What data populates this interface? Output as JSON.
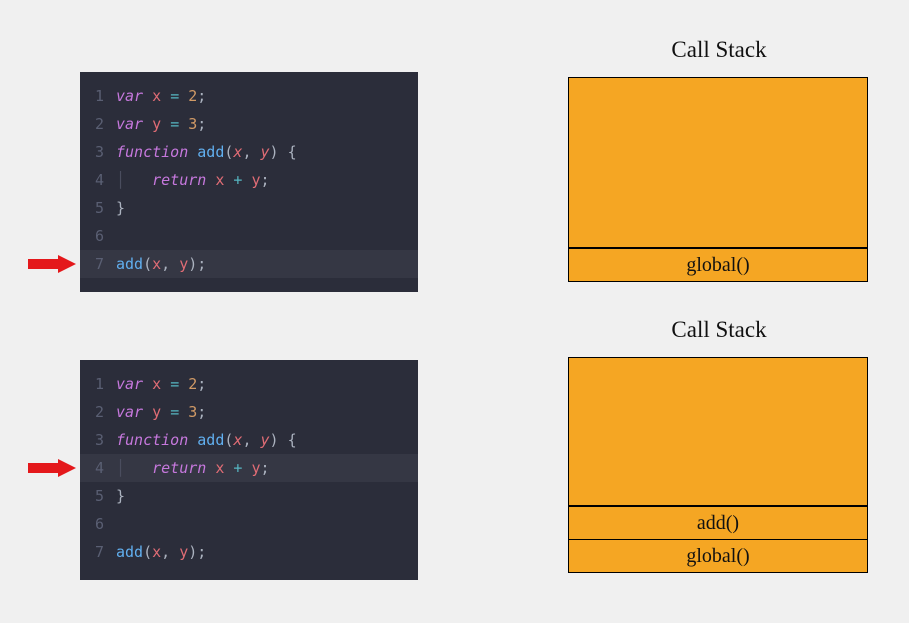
{
  "stacks": [
    {
      "title": "Call Stack",
      "emptyHeight": 170,
      "frames": [
        "global()"
      ]
    },
    {
      "title": "Call Stack",
      "emptyHeight": 148,
      "frames": [
        "add()",
        "global()"
      ]
    }
  ],
  "code": {
    "lines": [
      {
        "n": "1",
        "tokens": [
          {
            "t": "var ",
            "c": "tok-kw"
          },
          {
            "t": "x",
            "c": "tok-var"
          },
          {
            "t": " ",
            "c": "tok-white"
          },
          {
            "t": "=",
            "c": "tok-op"
          },
          {
            "t": " ",
            "c": "tok-white"
          },
          {
            "t": "2",
            "c": "tok-num"
          },
          {
            "t": ";",
            "c": "tok-punc"
          }
        ]
      },
      {
        "n": "2",
        "tokens": [
          {
            "t": "var ",
            "c": "tok-kw"
          },
          {
            "t": "y",
            "c": "tok-var"
          },
          {
            "t": " ",
            "c": "tok-white"
          },
          {
            "t": "=",
            "c": "tok-op"
          },
          {
            "t": " ",
            "c": "tok-white"
          },
          {
            "t": "3",
            "c": "tok-num"
          },
          {
            "t": ";",
            "c": "tok-punc"
          }
        ]
      },
      {
        "n": "3",
        "tokens": [
          {
            "t": "function ",
            "c": "tok-kw"
          },
          {
            "t": "add",
            "c": "tok-fn"
          },
          {
            "t": "(",
            "c": "tok-punc"
          },
          {
            "t": "x",
            "c": "tok-param"
          },
          {
            "t": ", ",
            "c": "tok-punc"
          },
          {
            "t": "y",
            "c": "tok-param"
          },
          {
            "t": ") {",
            "c": "tok-punc"
          }
        ]
      },
      {
        "n": "4",
        "tokens": [
          {
            "t": "│   ",
            "c": "guide"
          },
          {
            "t": "return ",
            "c": "tok-return"
          },
          {
            "t": "x",
            "c": "tok-var"
          },
          {
            "t": " ",
            "c": "tok-white"
          },
          {
            "t": "+",
            "c": "tok-op"
          },
          {
            "t": " ",
            "c": "tok-white"
          },
          {
            "t": "y",
            "c": "tok-var"
          },
          {
            "t": ";",
            "c": "tok-punc"
          }
        ]
      },
      {
        "n": "5",
        "tokens": [
          {
            "t": "}",
            "c": "tok-punc"
          }
        ]
      },
      {
        "n": "6",
        "tokens": []
      },
      {
        "n": "7",
        "tokens": [
          {
            "t": "add",
            "c": "tok-fn"
          },
          {
            "t": "(",
            "c": "tok-punc"
          },
          {
            "t": "x",
            "c": "tok-var"
          },
          {
            "t": ", ",
            "c": "tok-punc"
          },
          {
            "t": "y",
            "c": "tok-var"
          },
          {
            "t": ");",
            "c": "tok-punc"
          }
        ]
      }
    ]
  },
  "panels": [
    {
      "highlightLine": 7,
      "arrowLine": 7
    },
    {
      "highlightLine": 4,
      "arrowLine": 4
    }
  ]
}
